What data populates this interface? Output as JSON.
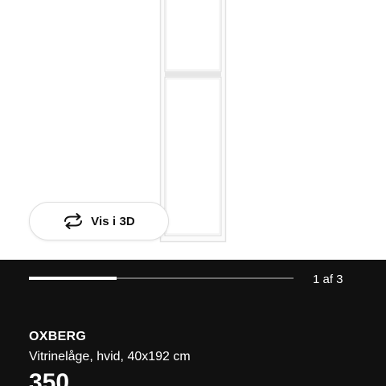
{
  "image_viewer": {
    "product_image_alt": "OXBERG glass door",
    "view_3d_label": "Vis i 3D",
    "view_3d_icon": "rotate-arrows-icon",
    "slide_progress": 0.33
  },
  "gallery": {
    "page_counter": "1 af 3"
  },
  "product": {
    "name": "OXBERG",
    "description": "Vitrinelåge, hvid, 40x192 cm",
    "price_partial": "350"
  },
  "colors": {
    "panel_background": "#111111",
    "progress_track": "#6b6b6b",
    "progress_fill": "#ffffff"
  }
}
